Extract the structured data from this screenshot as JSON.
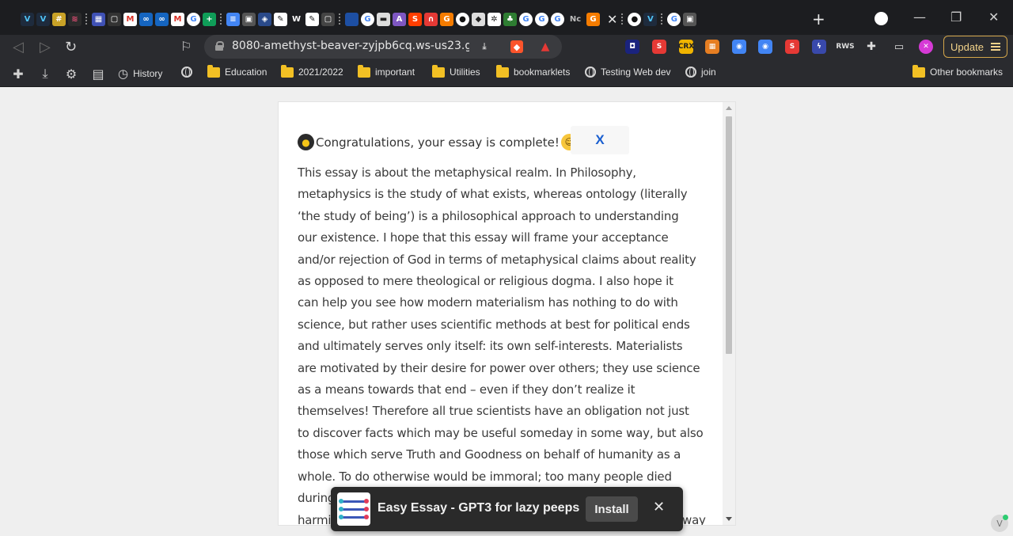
{
  "browser": {
    "url": "8080-amethyst-beaver-zyjpb6cq.ws-us23.git...",
    "update_label": "Update",
    "tab_close": "✕",
    "new_tab": "+",
    "tab_labels": [
      "W",
      "Nc"
    ]
  },
  "bookmarks": {
    "history": "History",
    "items": [
      "Education",
      "2021/2022",
      "important",
      "Utilities",
      "bookmarklets",
      "Testing Web dev",
      "join"
    ],
    "other": "Other bookmarks"
  },
  "extensions_labels": {
    "crx": "CRX",
    "rws": "RWS"
  },
  "popup": {
    "header": "Congratulations, your essay is complete!",
    "close_label": "X",
    "essay_lines": [
      "This essay is about the metaphysical realm. In Philosophy,",
      "metaphysics is the study of what exists, whereas ontology (literally",
      "‘the study of being’) is a philosophical approach to understanding",
      "our existence. I hope that this essay will frame your acceptance",
      "and/or rejection of God in terms of metaphysical claims about reality",
      "as opposed to mere theological or religious dogma. I also hope it",
      "can help you see how modern materialism has nothing to do with",
      "science, but rather uses scientific methods at best for political ends",
      "and ultimately serves only itself: its own self-interests. Materialists",
      "are motivated by their desire for power over others; they use science",
      "as a means towards that end – even if they don’t realize it",
      "themselves! Therefore all true scientists have an obligation not just",
      "to discover facts which may be useful someday in some way, but also",
      "those which serve Truth and Goodness on behalf of humanity as a",
      "whole. To do otherwise would be immoral; too many people died",
      "during",
      "harmi"
    ],
    "essay_tail": "way"
  },
  "install_prompt": {
    "title": "Easy Essay - GPT3 for lazy peeps",
    "install_label": "Install",
    "close_label": "✕"
  },
  "colors": {
    "accent_link": "#1a5fd0",
    "folder": "#f2c024",
    "update_border": "#d4a64a"
  }
}
